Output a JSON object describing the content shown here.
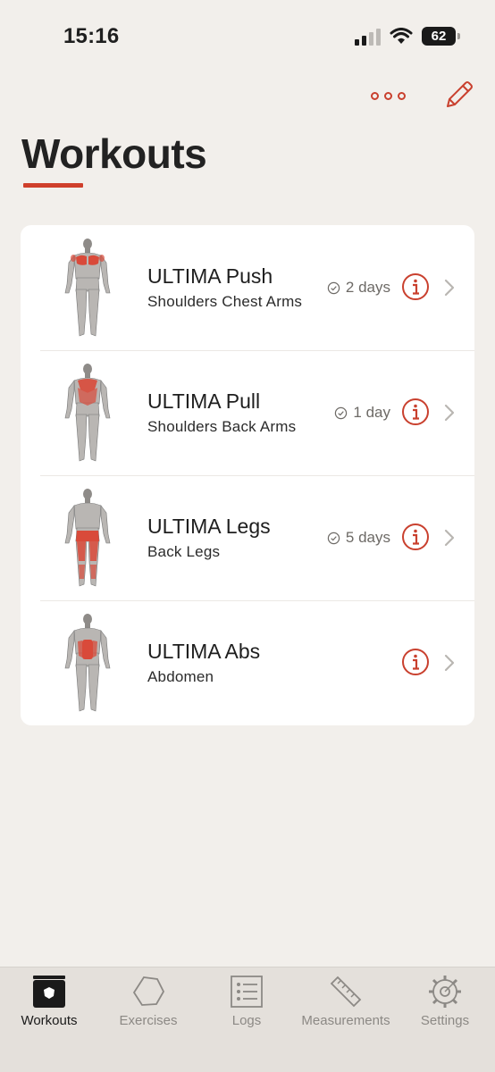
{
  "status_bar": {
    "time": "15:16",
    "battery": "62"
  },
  "header": {
    "title": "Workouts"
  },
  "workouts": [
    {
      "title": "ULTIMA Push",
      "subtitle": "Shoulders Chest Arms",
      "last": "2 days",
      "view": "front",
      "highlight": "chest"
    },
    {
      "title": "ULTIMA Pull",
      "subtitle": "Shoulders Back Arms",
      "last": "1 day",
      "view": "back",
      "highlight": "back"
    },
    {
      "title": "ULTIMA Legs",
      "subtitle": "Back Legs",
      "last": "5 days",
      "view": "back",
      "highlight": "legs"
    },
    {
      "title": "ULTIMA Abs",
      "subtitle": "Abdomen",
      "last": "",
      "view": "front",
      "highlight": "abs"
    }
  ],
  "tabs": [
    {
      "label": "Workouts",
      "icon": "workouts-icon",
      "active": true
    },
    {
      "label": "Exercises",
      "icon": "hexagon-icon",
      "active": false
    },
    {
      "label": "Logs",
      "icon": "list-icon",
      "active": false
    },
    {
      "label": "Measurements",
      "icon": "ruler-icon",
      "active": false
    },
    {
      "label": "Settings",
      "icon": "gear-icon",
      "active": false
    }
  ],
  "colors": {
    "accent": "#cf3f2b",
    "background": "#f2efeb",
    "muscle": "#d94a3a"
  }
}
